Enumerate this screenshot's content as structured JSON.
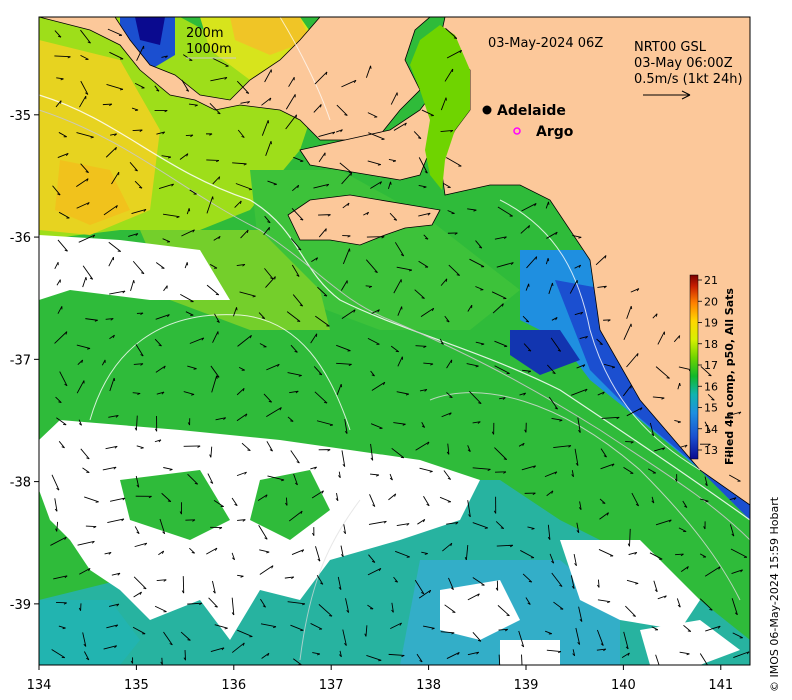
{
  "header": {
    "timestamp": "03-May-2024 06Z",
    "contour_labels": [
      "200m",
      "1000m"
    ],
    "current_source": "NRT00 GSL",
    "current_time": "03-May 06:00Z",
    "vector_scale": "0.5m/s (1kt 24h)"
  },
  "places": [
    {
      "name": "Adelaide",
      "lon": 138.58,
      "lat": -34.93,
      "marker": "filled-circle",
      "color": "#000000"
    },
    {
      "name": "Argo",
      "lon": 138.86,
      "lat": -35.12,
      "marker": "open-circle",
      "color": "#ff00ff"
    }
  ],
  "axes": {
    "x_ticks": [
      "134",
      "135",
      "136",
      "137",
      "138",
      "139",
      "140",
      "141"
    ],
    "y_ticks": [
      "-35",
      "-36",
      "-37",
      "-38",
      "-39"
    ],
    "x_range": [
      134,
      141.3
    ],
    "y_range": [
      -39.5,
      -34.2
    ]
  },
  "colorbar": {
    "label": "Filled 4h comp, p50, All Sats",
    "ticks": [
      "21",
      "20",
      "19",
      "18",
      "17",
      "16",
      "15",
      "14",
      "13"
    ],
    "colors": [
      "#7a0000",
      "#c81e00",
      "#ff7f00",
      "#ffd600",
      "#d8f000",
      "#6fd400",
      "#12b82a",
      "#11b3b0",
      "#1e8fe0",
      "#1b4fd0",
      "#0a0a8f"
    ]
  },
  "credit": "© IMOS 06-May-2024 15:59 Hobart"
}
